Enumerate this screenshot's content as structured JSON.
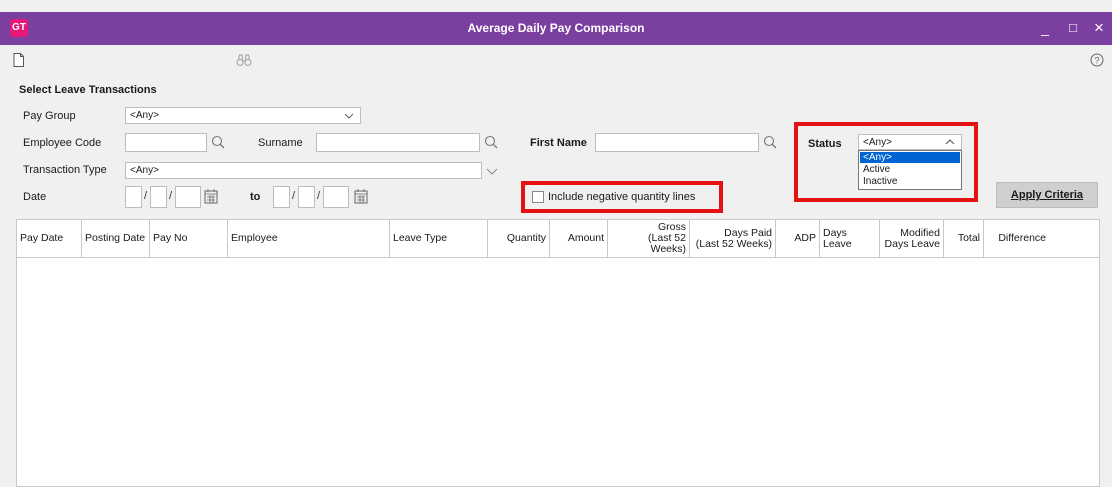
{
  "window": {
    "logo": "GT",
    "title": "Average Daily Pay Comparison",
    "controls": {
      "minimize": "_",
      "maximize": "□",
      "close": "×"
    }
  },
  "toolbar": {
    "icons": [
      "new-document-icon",
      "binoculars-icon",
      "help-icon"
    ],
    "help_glyph": "?"
  },
  "filters": {
    "section_title": "Select Leave Transactions",
    "pay_group": {
      "label": "Pay Group",
      "value": "<Any>"
    },
    "employee_code": {
      "label": "Employee Code",
      "value": ""
    },
    "surname": {
      "label": "Surname",
      "value": ""
    },
    "first_name": {
      "label": "First Name",
      "value": ""
    },
    "status": {
      "label": "Status",
      "value": "<Any>",
      "options": [
        "<Any>",
        "Active",
        "Inactive"
      ],
      "selected_index": 0
    },
    "transaction_type": {
      "label": "Transaction Type",
      "value": "<Any>"
    },
    "date": {
      "label": "Date",
      "to_label": "to",
      "separator": "/"
    },
    "include_negative": {
      "label": "Include negative quantity lines",
      "checked": false
    },
    "apply_button": "Apply Criteria"
  },
  "grid": {
    "columns": [
      {
        "line1": "Pay Date",
        "line2": ""
      },
      {
        "line1": "Posting Date",
        "line2": ""
      },
      {
        "line1": "Pay No",
        "line2": ""
      },
      {
        "line1": "Employee",
        "line2": ""
      },
      {
        "line1": "Leave Type",
        "line2": ""
      },
      {
        "line1": "Quantity",
        "line2": ""
      },
      {
        "line1": "Amount",
        "line2": ""
      },
      {
        "line1": "Gross",
        "line2": "(Last 52 Weeks)"
      },
      {
        "line1": "Days Paid",
        "line2": "(Last 52 Weeks)"
      },
      {
        "line1": "ADP",
        "line2": ""
      },
      {
        "line1": "Days Leave",
        "line2": ""
      },
      {
        "line1": "Modified",
        "line2": "Days Leave"
      },
      {
        "line1": "Total",
        "line2": ""
      },
      {
        "line1": "Difference",
        "line2": ""
      }
    ],
    "rows": []
  },
  "colors": {
    "titlebar": "#7b3fa0",
    "logo": "#e6197a",
    "highlight": "#e41212",
    "selection": "#0064d2"
  }
}
